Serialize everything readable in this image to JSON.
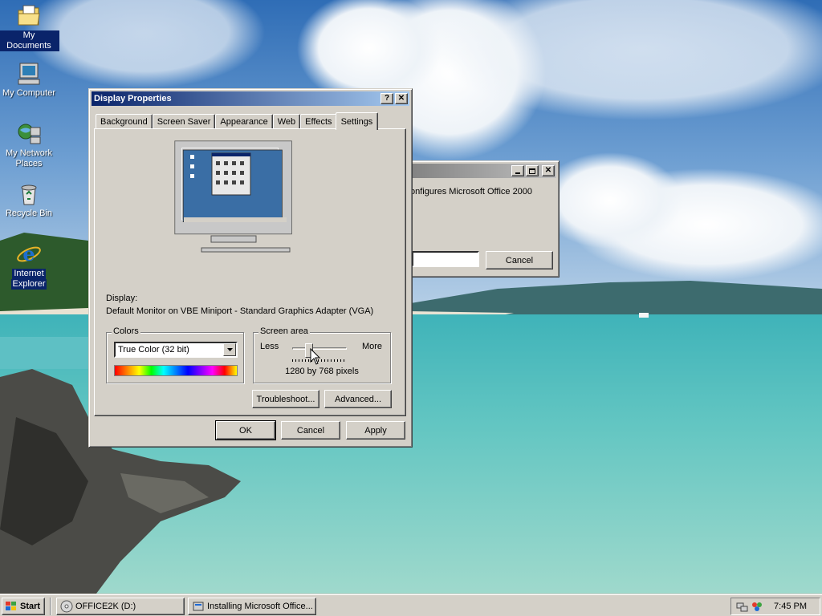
{
  "desktop": {
    "icons": [
      {
        "label": "My Documents",
        "icon": "folder-documents-icon",
        "selected": true
      },
      {
        "label": "My Computer",
        "icon": "computer-icon",
        "selected": false
      },
      {
        "label_line1": "My Network",
        "label_line2": "Places",
        "icon": "network-places-icon",
        "selected": false
      },
      {
        "label": "Recycle Bin",
        "icon": "recycle-bin-icon",
        "selected": false
      },
      {
        "label_line1": "Internet",
        "label_line2": "Explorer",
        "icon": "internet-explorer-icon",
        "selected": true
      }
    ]
  },
  "background_window": {
    "title": "",
    "text": "onfigures Microsoft Office 2000",
    "cancel_label": "Cancel"
  },
  "dialog": {
    "title": "Display Properties",
    "help_btn": "?",
    "close_btn": "✕",
    "tabs": [
      "Background",
      "Screen Saver",
      "Appearance",
      "Web",
      "Effects",
      "Settings"
    ],
    "active_tab": "Settings",
    "display_label": "Display:",
    "display_value": "Default Monitor on VBE Miniport - Standard Graphics Adapter (VGA)",
    "colors": {
      "legend": "Colors",
      "selected": "True Color (32 bit)"
    },
    "screen_area": {
      "legend": "Screen area",
      "less": "Less",
      "more": "More",
      "resolution": "1280 by 768 pixels",
      "slider_fraction": 0.28
    },
    "troubleshoot_label": "Troubleshoot...",
    "advanced_label": "Advanced...",
    "ok_label": "OK",
    "cancel_label": "Cancel",
    "apply_label": "Apply"
  },
  "taskbar": {
    "start_label": "Start",
    "tasks": [
      {
        "label": "OFFICE2K (D:)",
        "icon": "cd-drive-icon"
      },
      {
        "label": "Installing Microsoft Office...",
        "icon": "installer-icon"
      }
    ],
    "clock": "7:45 PM"
  },
  "colors": {
    "active_title": "#0a246a",
    "face": "#d4d0c8"
  }
}
